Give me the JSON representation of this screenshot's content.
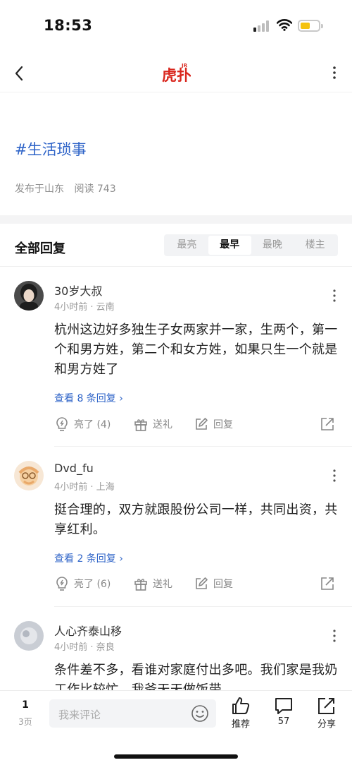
{
  "status_bar": {
    "time": "18:53"
  },
  "nav": {
    "logo_text": "虎扑",
    "logo_small": "JR"
  },
  "post": {
    "topic": "#生活琐事",
    "location": "发布于山东",
    "reads": "阅读 743"
  },
  "replies": {
    "title": "全部回复",
    "sort_tabs": [
      "最亮",
      "最早",
      "最晚",
      "楼主"
    ],
    "active_tab": "最早"
  },
  "comments": [
    {
      "name": "30岁大叔",
      "meta": "4小时前 · 云南",
      "text": "杭州这边好多独生子女两家并一家，生两个，第一个和男方姓，第二个和女方姓，如果只生一个就是和男方姓了",
      "view_replies": "查看 8 条回复",
      "likes": "亮了 (4)",
      "gift": "送礼",
      "reply": "回复"
    },
    {
      "name": "Dvd_fu",
      "meta": "4小时前 · 上海",
      "text": "挺合理的，双方就跟股份公司一样，共同出资，共享红利。",
      "view_replies": "查看 2 条回复",
      "likes": "亮了 (6)",
      "gift": "送礼",
      "reply": "回复"
    },
    {
      "name": "人心齐泰山移",
      "meta": "4小时前 · 奈良",
      "text": "条件差不多，看谁对家庭付出多吧。我们家是我奶工作比较忙，我爷天天做饭带"
    }
  ],
  "bottom_bar": {
    "page": "1",
    "total_pages": "3页",
    "input_placeholder": "我来评论",
    "recommend_label": "推荐",
    "comment_count": "57",
    "share_label": "分享"
  },
  "colors": {
    "link_blue": "#2f64c8",
    "logo_red": "#d9251c",
    "battery_yellow": "#f4c20d"
  }
}
